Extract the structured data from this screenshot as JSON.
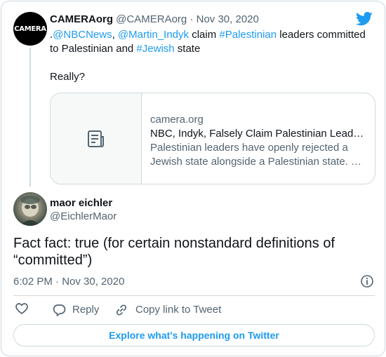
{
  "brand_color": "#1d9bf0",
  "parent_tweet": {
    "avatar_text": "CAMERA",
    "display_name": "CAMERAorg",
    "handle": "@CAMERAorg",
    "separator": "·",
    "date": "Nov 30, 2020",
    "text": {
      "prefix": ".",
      "mention_1": "@NBCNews",
      "comma": ",",
      "mention_2": "@Martin_Indyk",
      "claim": " claim ",
      "hashtag_1": "#Palestinian",
      "after_hashtag_1": " leaders committed",
      "line2_start": "to Palestinian and ",
      "hashtag_2": "#Jewish",
      "line2_end": " state",
      "line3": "Really?"
    },
    "link_card": {
      "thumb_icon": "document-icon",
      "domain": "camera.org",
      "title": "NBC, Indyk, Falsely Claim Palestinian Leaders Committed to Jewish State",
      "desc_line1": "Palestinian leaders have openly rejected a",
      "desc_line2": "Jewish state alongside a Palestinian state. …"
    }
  },
  "main_tweet": {
    "display_name": "maor eichler",
    "handle": "@EichlerMaor",
    "text_line1": "Fact fact: true (for certain nonstandard definitions of",
    "text_line2": "“committed”)",
    "timestamp": "6:02 PM · Nov 30, 2020"
  },
  "actions": {
    "like_icon": "heart-icon",
    "reply_label": "Reply",
    "copy_link_label": "Copy link to Tweet"
  },
  "explore_button": "Explore what's happening on Twitter"
}
